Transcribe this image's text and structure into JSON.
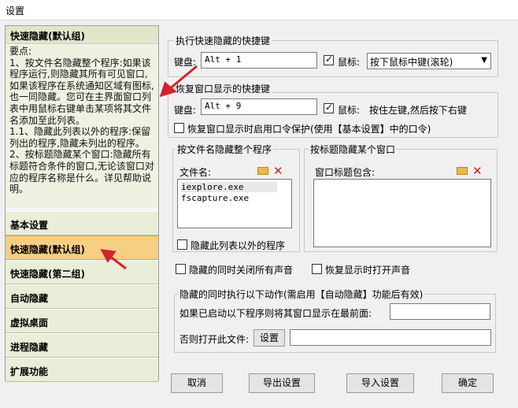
{
  "window": {
    "title": "设置"
  },
  "left": {
    "header": "快速隐藏(默认组)",
    "help_text": "要点:\n1、按文件名隐藏整个程序:如果该程序运行,则隐藏其所有可见窗口,如果该程序在系统通知区域有图标,也一同隐藏。您可在主界面窗口列表中用鼠标右键单击某项将其文件名添加至此列表。\n1.1、隐藏此列表以外的程序:保留列出的程序,隐藏未列出的程序。\n2、按标题隐藏某个窗口:隐藏所有标题符合条件的窗口,无论该窗口对应的程序名称是什么。详见帮助说明。",
    "nav": [
      "基本设置",
      "快速隐藏(默认组)",
      "快速隐藏(第二组)",
      "自动隐藏",
      "虚拟桌面",
      "进程隐藏",
      "扩展功能"
    ],
    "active_index": 1
  },
  "hide_hotkey": {
    "legend": "执行快速隐藏的快捷键",
    "keyboard_label": "键盘:",
    "keyboard_value": "Alt + 1",
    "mouse_label": "鼠标:",
    "mouse_checked": true,
    "mouse_option": "按下鼠标中键(滚轮)"
  },
  "restore_hotkey": {
    "legend": "恢复窗口显示的快捷键",
    "keyboard_label": "键盘:",
    "keyboard_value": "Alt + 9",
    "mouse_label": "鼠标:",
    "mouse_checked": true,
    "mouse_text": "按住左键,然后按下右键",
    "password_label": "恢复窗口显示时启用口令保护(使用【基本设置】中的口令)",
    "password_checked": false
  },
  "by_filename": {
    "legend": "按文件名隐藏整个程序",
    "list_label": "文件名:",
    "items": [
      "iexplore.exe",
      "fscapture.exe"
    ],
    "except_label": "隐藏此列表以外的程序",
    "except_checked": false
  },
  "by_title": {
    "legend": "按标题隐藏某个窗口",
    "list_label": "窗口标题包含:"
  },
  "options": {
    "mute_label": "隐藏的同时关闭所有声音",
    "mute_checked": false,
    "unmute_label": "恢复显示时打开声音",
    "unmute_checked": false
  },
  "actions": {
    "legend": "隐藏的同时执行以下动作(需启用【自动隐藏】功能后有效)",
    "front_label": "如果已启动以下程序则将其窗口显示在最前面:",
    "front_value": "",
    "open_label": "否则打开此文件:",
    "open_button": "设置",
    "open_value": ""
  },
  "buttons": {
    "cancel": "取消",
    "export": "导出设置",
    "import": "导入设置",
    "ok": "确定"
  },
  "colors": {
    "active_nav": "#f7cf84",
    "nav_bg": "#e8eed7",
    "arrow": "#d6232a"
  }
}
